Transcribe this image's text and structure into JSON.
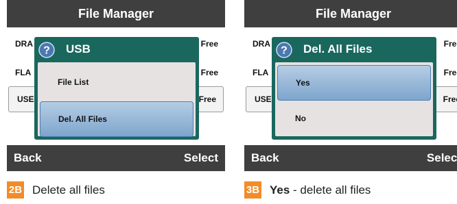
{
  "panels": [
    {
      "title": "File Manager",
      "rows": [
        {
          "name": "DRA",
          "free": "Free"
        },
        {
          "name": "FLA",
          "free": "Free"
        },
        {
          "name": "USE",
          "free": "Free"
        }
      ],
      "dialog": {
        "title": "USB",
        "icon": "help-icon",
        "items": [
          {
            "label": "File List"
          },
          {
            "label": "Del. All Files"
          }
        ]
      },
      "back_label": "Back",
      "select_label": "Select",
      "caption": {
        "badge": "2B",
        "bold": "",
        "text": "Delete all files"
      }
    },
    {
      "title": "File Manager",
      "rows": [
        {
          "name": "DRA",
          "free": "Free"
        },
        {
          "name": "FLA",
          "free": "Free"
        },
        {
          "name": "USE",
          "free": "Free"
        }
      ],
      "dialog": {
        "title": "Del. All Files",
        "icon": "help-icon",
        "items": [
          {
            "label": "Yes"
          },
          {
            "label": "No"
          }
        ]
      },
      "back_label": "Back",
      "select_label": "Select",
      "caption": {
        "badge": "3B",
        "bold": "Yes",
        "text": " - delete all files"
      }
    }
  ],
  "colors": {
    "bar": "#3f3f3f",
    "dialog": "#1a675e",
    "selection": "#7ea5cc",
    "badge": "#f28c28"
  }
}
